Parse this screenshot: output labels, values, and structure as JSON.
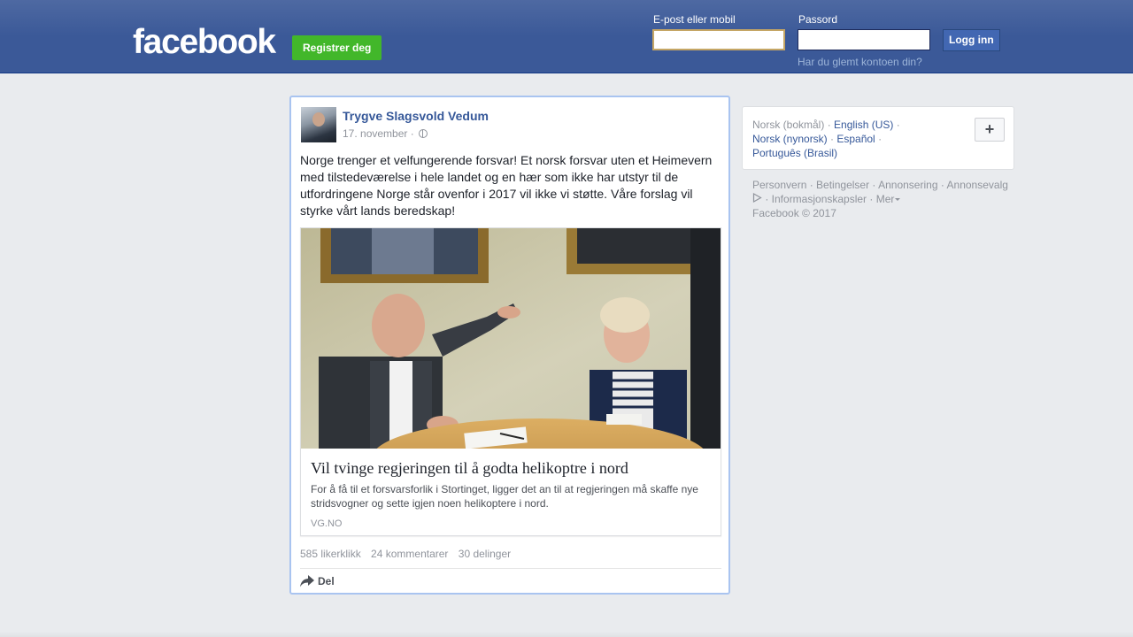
{
  "header": {
    "logo": "facebook",
    "register_label": "Registrer deg",
    "email_label": "E-post eller mobil",
    "email_value": "",
    "password_label": "Passord",
    "password_value": "",
    "login_label": "Logg inn",
    "forgot_label": "Har du glemt kontoen din?"
  },
  "post": {
    "author": "Trygve Slagsvold Vedum",
    "date": "17. november",
    "separator": "·",
    "privacy_icon": "globe-icon",
    "text": "Norge trenger et velfungerende forsvar! Et norsk forsvar uten et Heimevern med tilstedeværelse i hele landet og en hær som ikke har utstyr til de utfordringene Norge står ovenfor i 2017 vil ikke vi støtte. Våre forslag vil styrke vårt lands beredskap!",
    "link": {
      "title": "Vil tvinge regjeringen til å godta helikoptre i nord",
      "description": "For å få til et forsvarsforlik i Stortinget, ligger det an til at regjeringen må skaffe nye stridsvogner og sette igjen noen helikoptere i nord.",
      "domain": "VG.NO"
    },
    "stats": {
      "likes": "585 likerklikk",
      "comments": "24 kommentarer",
      "shares": "30 delinger"
    },
    "share_label": "Del",
    "share_icon": "share-arrow-icon"
  },
  "languages": {
    "current": "Norsk (bokmål)",
    "options": [
      "English (US)",
      "Norsk (nynorsk)",
      "Español",
      "Português (Brasil)"
    ],
    "more_icon": "plus-icon"
  },
  "footer": {
    "links": [
      "Personvern",
      "Betingelser",
      "Annonsering",
      "Annonsevalg",
      "Informasjonskapsler",
      "Mer"
    ],
    "copyright": "Facebook © 2017"
  },
  "colors": {
    "brand_blue": "#3b5998",
    "register_green": "#42b72a",
    "link_blue": "#365899",
    "background": "#e9ebee"
  }
}
